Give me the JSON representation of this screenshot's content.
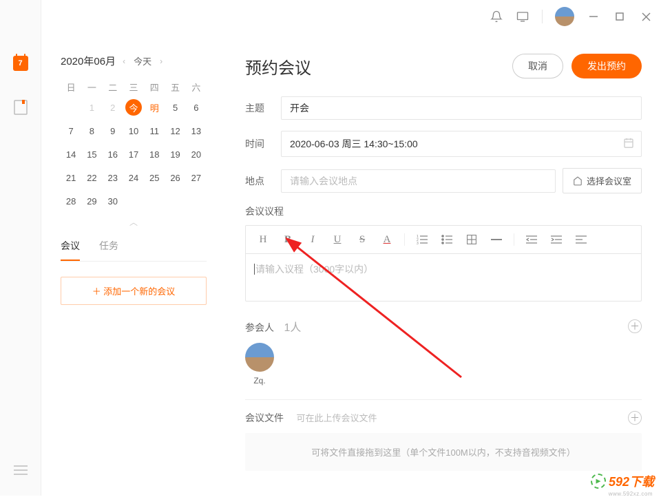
{
  "rail": {
    "calendar_day": "7"
  },
  "titlebar": {},
  "calendar": {
    "month_label": "2020年06月",
    "today_btn": "今天",
    "weekdays": [
      "日",
      "一",
      "二",
      "三",
      "四",
      "五",
      "六"
    ],
    "rows": [
      [
        "",
        "1",
        "2",
        "今",
        "明",
        "5",
        "6"
      ],
      [
        "7",
        "8",
        "9",
        "10",
        "11",
        "12",
        "13"
      ],
      [
        "14",
        "15",
        "16",
        "17",
        "18",
        "19",
        "20"
      ],
      [
        "21",
        "22",
        "23",
        "24",
        "25",
        "26",
        "27"
      ],
      [
        "28",
        "29",
        "30",
        "",
        "",
        "",
        ""
      ]
    ],
    "today_text": "今",
    "tomorrow_text": "明"
  },
  "side_tabs": {
    "meeting": "会议",
    "task": "任务"
  },
  "add_meeting": "＋  添加一个新的会议",
  "main": {
    "title": "预约会议",
    "cancel": "取消",
    "submit": "发出预约",
    "subject_label": "主题",
    "subject_value": "开会",
    "time_label": "时间",
    "time_value": "2020-06-03 周三 14:30~15:00",
    "location_label": "地点",
    "location_placeholder": "请输入会议地点",
    "room_btn": "选择会议室",
    "agenda_label": "会议议程",
    "agenda_placeholder": "请输入议程（3000字以内）",
    "attendee_label": "参会人",
    "attendee_count": "1人",
    "attendees": [
      {
        "name": "Zq."
      }
    ],
    "files_label": "会议文件",
    "files_hint": "可在此上传会议文件",
    "dropzone": "可将文件直接拖到这里（单个文件100M以内，不支持音视频文件）"
  },
  "watermark": {
    "text": "592下载",
    "sub": "www.592xz.com"
  }
}
